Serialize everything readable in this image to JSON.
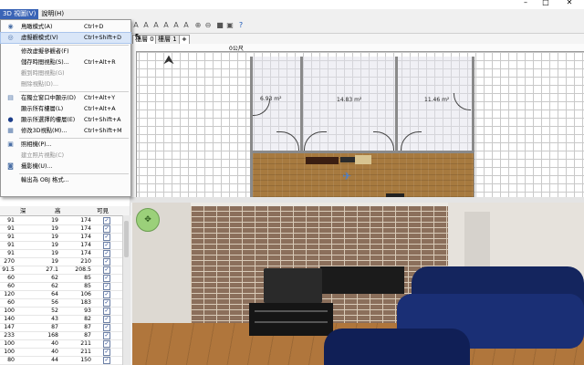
{
  "menubar": {
    "items": [
      "3D 視圖(V)",
      "說明(H)"
    ]
  },
  "window": {
    "minimize": "–",
    "maximize": "□",
    "close": "✕"
  },
  "dropdown": {
    "items": [
      {
        "label": "鳥瞰模式(A)",
        "shortcut": "Ctrl+D",
        "icon": "bird-view-icon",
        "disabled": false,
        "highlight": false
      },
      {
        "label": "虛擬觀模式(V)",
        "shortcut": "Ctrl+Shift+D",
        "icon": "virtual-visit-icon",
        "disabled": false,
        "highlight": true
      },
      {
        "label": "修改虛擬參觀者(F)",
        "shortcut": "",
        "icon": "",
        "disabled": false,
        "highlight": false
      },
      {
        "label": "儲存時間視點(S)...",
        "shortcut": "Ctrl+Alt+R",
        "icon": "",
        "disabled": false,
        "highlight": false
      },
      {
        "label": "觀到時間視點(G)",
        "shortcut": "",
        "icon": "",
        "disabled": true,
        "highlight": false
      },
      {
        "label": "刪除視點(D)...",
        "shortcut": "",
        "icon": "",
        "disabled": true,
        "highlight": false
      },
      {
        "label": "在獨立窗口中顯示(D)",
        "shortcut": "Ctrl+Alt+Y",
        "icon": "window-icon",
        "disabled": false,
        "highlight": false
      },
      {
        "label": "顯示所有樓層(L)",
        "shortcut": "Ctrl+Alt+A",
        "icon": "",
        "disabled": false,
        "highlight": false
      },
      {
        "label": "顯示所選擇的樓層(E)",
        "shortcut": "Ctrl+Shift+A",
        "icon": "radio-dot-icon",
        "disabled": false,
        "highlight": false
      },
      {
        "label": "修改3D視點(M)...",
        "shortcut": "Ctrl+Shift+M",
        "icon": "modify-3d-icon",
        "disabled": false,
        "highlight": false
      },
      {
        "label": "照相機(P)...",
        "shortcut": "",
        "icon": "camera-icon",
        "disabled": false,
        "highlight": false
      },
      {
        "label": "建立照片視點(C)",
        "shortcut": "",
        "icon": "",
        "disabled": true,
        "highlight": false
      },
      {
        "label": "攝影機(U)...",
        "shortcut": "",
        "icon": "video-camera-icon",
        "disabled": false,
        "highlight": false
      },
      {
        "label": "輸出為 OBJ 格式...",
        "shortcut": "",
        "icon": "",
        "disabled": false,
        "highlight": false
      }
    ]
  },
  "plan": {
    "tabs": [
      "樓層 0",
      "樓層 1",
      "+"
    ],
    "ruler_origin": "0公尺",
    "rooms": [
      "6.93 m²",
      "14.83 m²",
      "11.46 m²"
    ]
  },
  "furniture_table": {
    "headers": [
      "深",
      "高",
      "可見"
    ],
    "rows": [
      [
        "91",
        "19",
        "174",
        "✓"
      ],
      [
        "91",
        "19",
        "174",
        "✓"
      ],
      [
        "91",
        "19",
        "174",
        "✓"
      ],
      [
        "91",
        "19",
        "174",
        "✓"
      ],
      [
        "91",
        "19",
        "174",
        "✓"
      ],
      [
        "270",
        "19",
        "210",
        "✓"
      ],
      [
        "91.5",
        "27.1",
        "208.5",
        "✓"
      ],
      [
        "60",
        "62",
        "85",
        "✓"
      ],
      [
        "60",
        "62",
        "85",
        "✓"
      ],
      [
        "120",
        "64",
        "106",
        "✓"
      ],
      [
        "60",
        "56",
        "183",
        "✓"
      ],
      [
        "100",
        "52",
        "93",
        "✓"
      ],
      [
        "140",
        "43",
        "82",
        "✓"
      ],
      [
        "147",
        "87",
        "87",
        "✓"
      ],
      [
        "233",
        "168",
        "87",
        "✓"
      ],
      [
        "100",
        "40",
        "211",
        "✓"
      ],
      [
        "100",
        "40",
        "211",
        "✓"
      ],
      [
        "80",
        "44",
        "150",
        "✓"
      ]
    ]
  }
}
